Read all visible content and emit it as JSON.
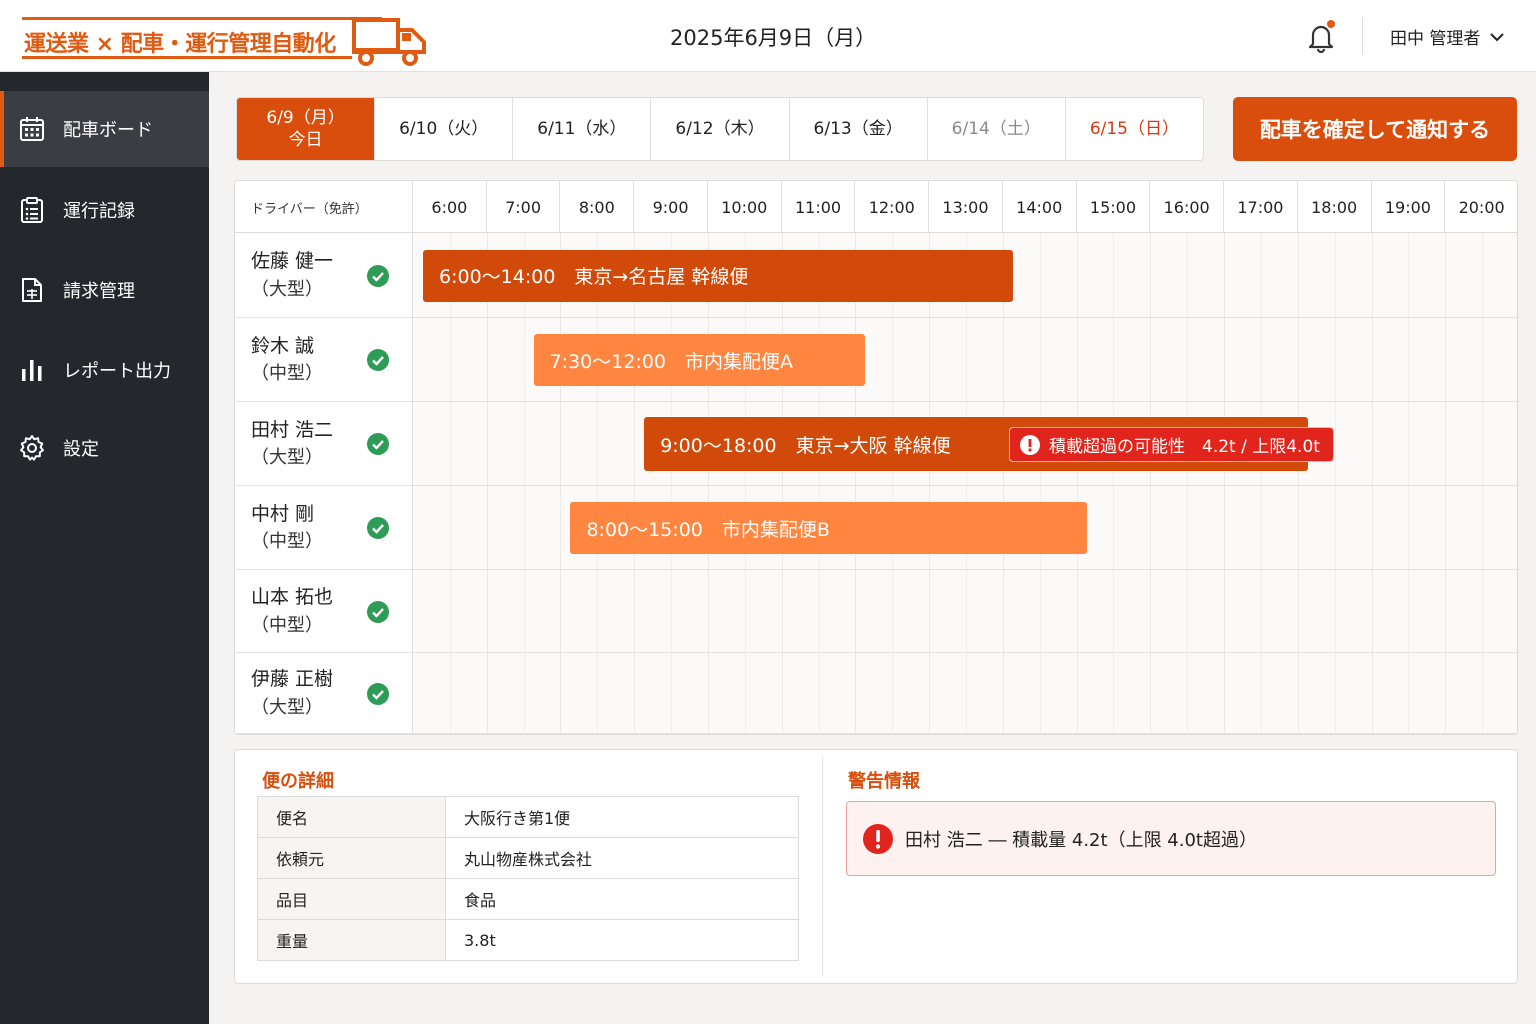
{
  "app": {
    "logo_text": "運送業 × 配車・運行管理自動化",
    "date": "2025年6月9日（月）",
    "user": "田中 管理者"
  },
  "sidebar": {
    "items": [
      {
        "label": "配車ボード",
        "icon": "calendar-icon",
        "active": true
      },
      {
        "label": "運行記録",
        "icon": "clipboard-icon",
        "active": false
      },
      {
        "label": "請求管理",
        "icon": "invoice-icon",
        "active": false
      },
      {
        "label": "レポート出力",
        "icon": "bar-chart-icon",
        "active": false
      },
      {
        "label": "設定",
        "icon": "gear-icon",
        "active": false
      }
    ]
  },
  "date_tabs": [
    {
      "date": "6/9（月）",
      "sub": "今日",
      "active": true
    },
    {
      "date": "6/10（火）"
    },
    {
      "date": "6/11（水）"
    },
    {
      "date": "6/12（木）"
    },
    {
      "date": "6/13（金）"
    },
    {
      "date": "6/14（土）"
    },
    {
      "date": "6/15（日）"
    }
  ],
  "confirm_button": "配車を確定して通知する",
  "schedule": {
    "driver_column_label": "ドライバー（免許）",
    "hours": [
      "6:00",
      "7:00",
      "8:00",
      "9:00",
      "10:00",
      "11:00",
      "12:00",
      "13:00",
      "14:00",
      "15:00",
      "16:00",
      "17:00",
      "18:00",
      "19:00",
      "20:00"
    ],
    "drivers": [
      {
        "name": "佐藤 健一",
        "license": "（大型）",
        "status": "ok"
      },
      {
        "name": "鈴木 誠",
        "license": "（中型）",
        "status": "ok"
      },
      {
        "name": "田村 浩二",
        "license": "（大型）",
        "status": "ok"
      },
      {
        "name": "中村 剛",
        "license": "（中型）",
        "status": "ok"
      },
      {
        "name": "山本 拓也",
        "license": "（中型）",
        "status": "ok"
      },
      {
        "name": "伊藤 正樹",
        "license": "（大型）",
        "status": "ok"
      }
    ],
    "trips": [
      {
        "driver": 0,
        "start": "6:00",
        "end": "14:00",
        "label": "6:00～14:00　東京→名古屋 幹線便",
        "style": "dark"
      },
      {
        "driver": 1,
        "start": "7:30",
        "end": "12:00",
        "label": "7:30～12:00　市内集配便A",
        "style": "light"
      },
      {
        "driver": 2,
        "start": "9:00",
        "end": "18:00",
        "label": "9:00～18:00　東京→大阪 幹線便",
        "style": "dark"
      },
      {
        "driver": 3,
        "start": "8:00",
        "end": "15:00",
        "label": "8:00～15:00　市内集配便B",
        "style": "light"
      }
    ],
    "warning_chip": "積載超過の可能性　4.2t / 上限4.0t"
  },
  "details": {
    "title": "便の詳細",
    "rows": [
      {
        "key": "便名",
        "value": "大阪行き第1便"
      },
      {
        "key": "依頼元",
        "value": "丸山物産株式会社"
      },
      {
        "key": "品目",
        "value": "食品"
      },
      {
        "key": "重量",
        "value": "3.8t"
      }
    ]
  },
  "warnings": {
    "title": "警告情報",
    "message": "田村 浩二 ― 積載量 4.2t（上限 4.0t超過）"
  },
  "colors": {
    "accent": "#d94e0c",
    "accent_light": "#fe8640",
    "danger": "#e1251c",
    "ok": "#2e9c57",
    "sidebar": "#24282c"
  }
}
